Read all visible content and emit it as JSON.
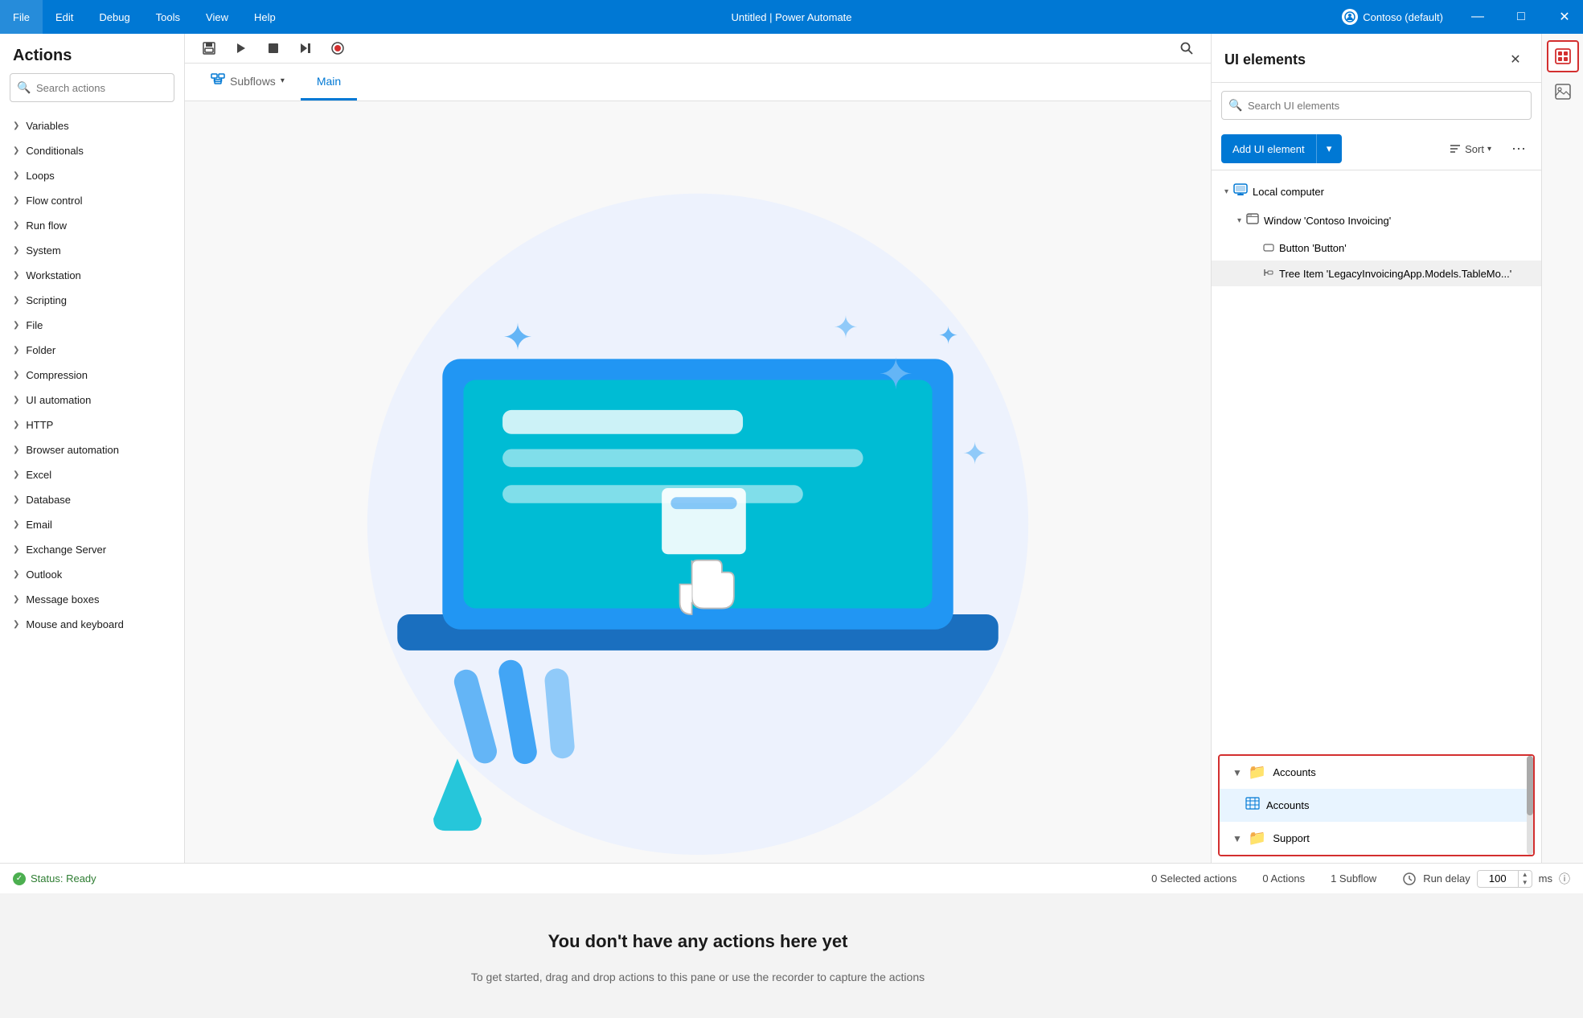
{
  "titlebar": {
    "menu_items": [
      "File",
      "Edit",
      "Debug",
      "Tools",
      "View",
      "Help"
    ],
    "title": "Untitled | Power Automate",
    "account": "Contoso (default)",
    "buttons": [
      "minimize",
      "maximize",
      "close"
    ]
  },
  "actions_panel": {
    "header": "Actions",
    "search_placeholder": "Search actions",
    "items": [
      "Variables",
      "Conditionals",
      "Loops",
      "Flow control",
      "Run flow",
      "System",
      "Workstation",
      "Scripting",
      "File",
      "Folder",
      "Compression",
      "UI automation",
      "HTTP",
      "Browser automation",
      "Excel",
      "Database",
      "Email",
      "Exchange Server",
      "Outlook",
      "Message boxes",
      "Mouse and keyboard"
    ]
  },
  "toolbar": {
    "buttons": [
      "save",
      "run",
      "stop",
      "step",
      "record"
    ]
  },
  "tabs": {
    "subflows_label": "Subflows",
    "main_label": "Main"
  },
  "canvas": {
    "empty_title": "You don't have any actions here yet",
    "empty_subtitle": "To get started, drag and drop actions to this pane\nor use the recorder to capture the actions"
  },
  "ui_elements": {
    "title": "UI elements",
    "search_placeholder": "Search UI elements",
    "add_button_label": "Add UI element",
    "sort_label": "Sort",
    "tree": [
      {
        "label": "Local computer",
        "level": 0,
        "type": "computer",
        "expanded": true
      },
      {
        "label": "Window 'Contoso Invoicing'",
        "level": 1,
        "type": "window",
        "expanded": true
      },
      {
        "label": "Button 'Button'",
        "level": 2,
        "type": "item"
      },
      {
        "label": "Tree Item 'LegacyInvoicingApp.Models.TableMo...'",
        "level": 2,
        "type": "item"
      }
    ],
    "bottom_tree": [
      {
        "label": "Accounts",
        "level": 0,
        "type": "folder",
        "expanded": true
      },
      {
        "label": "Accounts",
        "level": 1,
        "type": "table"
      },
      {
        "label": "Support",
        "level": 0,
        "type": "folder",
        "expanded": true
      }
    ]
  },
  "status_bar": {
    "status": "Status: Ready",
    "selected_actions": "0 Selected actions",
    "actions_count": "0 Actions",
    "subflow_count": "1 Subflow",
    "run_delay_label": "Run delay",
    "run_delay_value": "100",
    "run_delay_unit": "ms"
  }
}
